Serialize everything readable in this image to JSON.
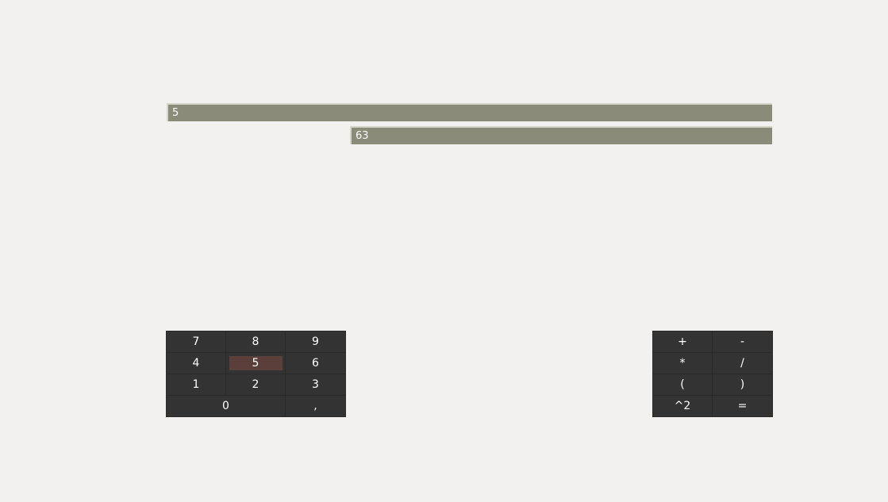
{
  "display": {
    "input_value": "5",
    "result_value": "63"
  },
  "digit_keys": [
    "7",
    "8",
    "9",
    "4",
    "5",
    "6",
    "1",
    "2",
    "3",
    "0",
    ","
  ],
  "operator_keys": [
    "+",
    "-",
    "*",
    "/",
    "(",
    ")",
    "^2",
    "="
  ],
  "active_key": "5",
  "colors": {
    "background": "#f2f1ef",
    "display_bg": "#8b8b7a",
    "key_bg": "#333333",
    "key_active": "#5a3f3b",
    "key_text": "#ffffff"
  }
}
